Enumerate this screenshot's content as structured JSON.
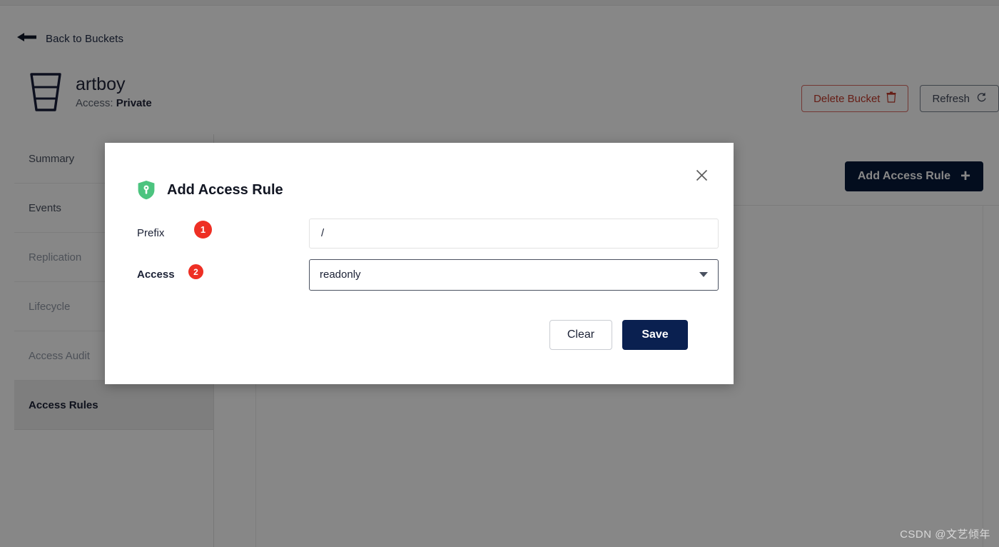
{
  "header": {
    "back_label": "Back to Buckets",
    "back_icon": "arrow-left-icon",
    "bucket_icon": "bucket-icon",
    "bucket_name": "artboy",
    "access_prefix": "Access: ",
    "access_value": "Private",
    "delete_label": "Delete Bucket",
    "delete_icon": "trash-icon",
    "refresh_label": "Refresh",
    "refresh_icon": "refresh-icon"
  },
  "sidebar": {
    "items": [
      {
        "label": "Summary",
        "state": "normal"
      },
      {
        "label": "Events",
        "state": "normal"
      },
      {
        "label": "Replication",
        "state": "muted"
      },
      {
        "label": "Lifecycle",
        "state": "muted"
      },
      {
        "label": "Access Audit",
        "state": "muted"
      },
      {
        "label": "Access Rules",
        "state": "active"
      }
    ]
  },
  "content": {
    "add_rule_label": "Add Access Rule",
    "add_rule_icon": "plus-icon"
  },
  "modal": {
    "title": "Add Access Rule",
    "title_icon": "shield-key-icon",
    "close_icon": "close-icon",
    "prefix": {
      "label": "Prefix",
      "badge": "1",
      "value": "/",
      "placeholder": "/"
    },
    "access": {
      "label": "Access",
      "badge": "2",
      "selected": "readonly",
      "caret_icon": "chevron-down-icon"
    },
    "clear_label": "Clear",
    "save_label": "Save"
  },
  "watermark": "CSDN @文艺倾年",
  "colors": {
    "primary_dark": "#0a2050",
    "danger": "#c0392b",
    "badge_red": "#ee2f24",
    "shield_green": "#4cc47f",
    "overlay": "rgba(0,0,0,0.47)"
  }
}
